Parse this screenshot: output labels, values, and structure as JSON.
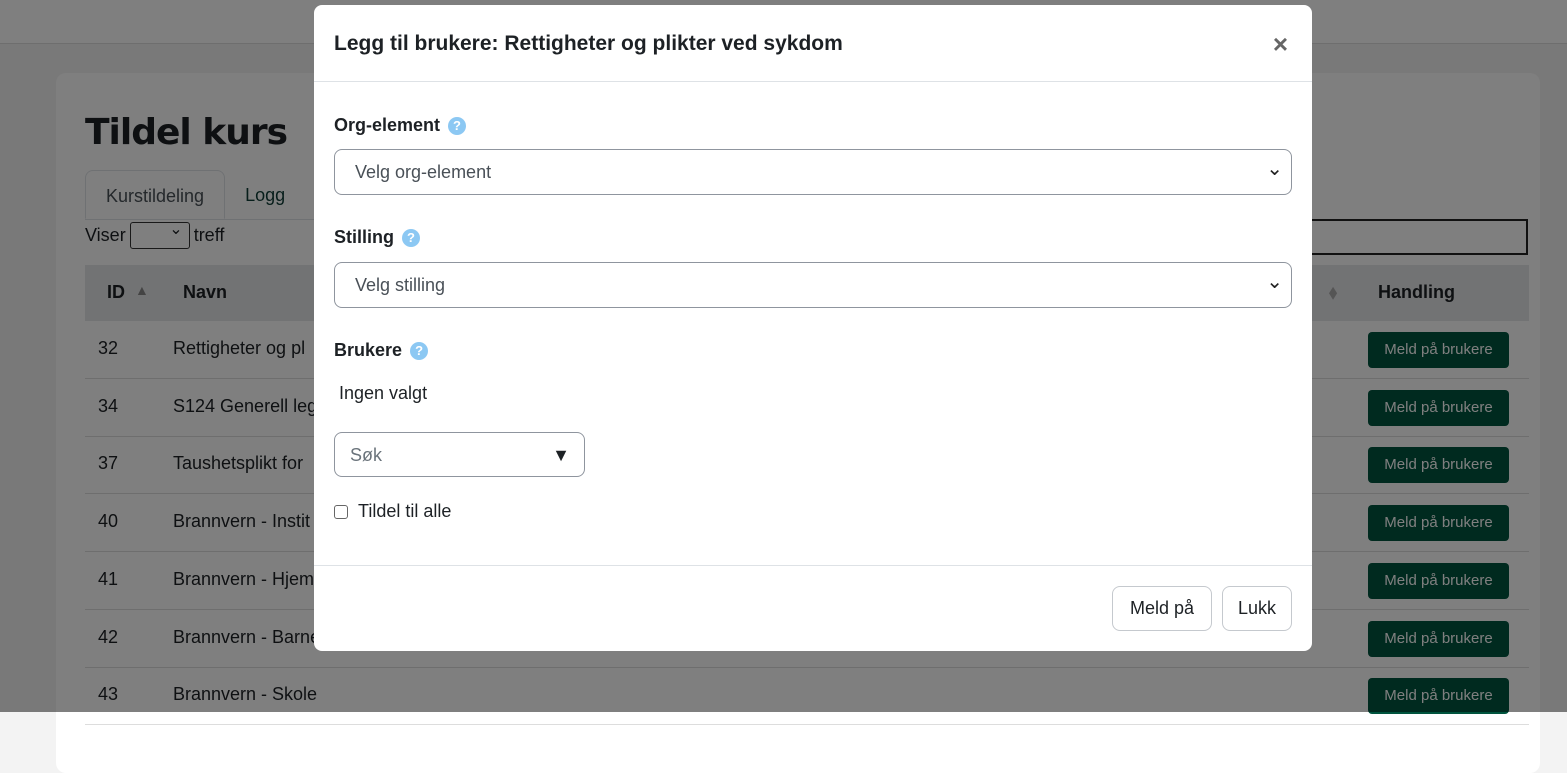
{
  "page": {
    "title": "Tildel kurs",
    "tabs": [
      {
        "label": "Kurstildeling"
      },
      {
        "label": "Logg"
      }
    ],
    "viser": "Viser",
    "treff": "treff",
    "table": {
      "headers": {
        "id": "ID",
        "navn": "Navn",
        "handling": "Handling"
      },
      "rows": [
        {
          "id": "32",
          "name": "Rettigheter og pl",
          "action": "Meld på brukere"
        },
        {
          "id": "34",
          "name": "S124 Generell leg",
          "action": "Meld på brukere"
        },
        {
          "id": "37",
          "name": "Taushetsplikt for",
          "action": "Meld på brukere"
        },
        {
          "id": "40",
          "name": "Brannvern - Instit",
          "action": "Meld på brukere"
        },
        {
          "id": "41",
          "name": "Brannvern - Hjem",
          "action": "Meld på brukere"
        },
        {
          "id": "42",
          "name": "Brannvern - Barne",
          "action": "Meld på brukere"
        },
        {
          "id": "43",
          "name": "Brannvern - Skole",
          "action": "Meld på brukere"
        }
      ]
    },
    "colors": {
      "action_button": "#00543e",
      "help_icon": "#8cc8f3"
    }
  },
  "modal": {
    "title": "Legg til brukere: Rettigheter og plikter ved sykdom",
    "close": "×",
    "org": {
      "label": "Org-element",
      "value": "Velg org-element"
    },
    "stilling": {
      "label": "Stilling",
      "value": "Velg stilling"
    },
    "brukere": {
      "label": "Brukere",
      "selected": "Ingen valgt",
      "search_placeholder": "Søk"
    },
    "assign_all": "Tildel til alle",
    "buttons": {
      "submit": "Meld på",
      "close": "Lukk"
    }
  }
}
